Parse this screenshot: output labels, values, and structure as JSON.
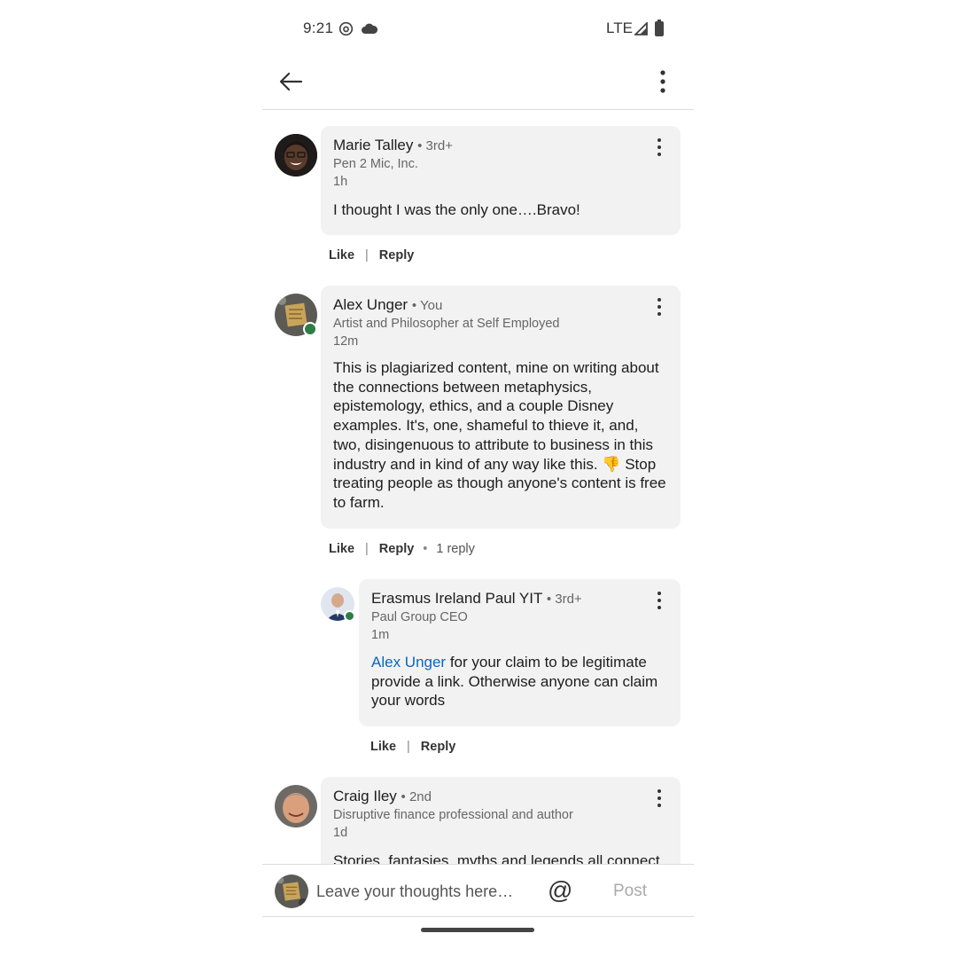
{
  "status_bar": {
    "time": "9:21",
    "network": "LTE"
  },
  "comments": [
    {
      "name": "Marie Talley",
      "degree": "• 3rd+",
      "headline": "Pen 2 Mic, Inc.",
      "time": "1h",
      "text": "I thought I was the only one….Bravo!",
      "like_label": "Like",
      "reply_label": "Reply"
    },
    {
      "name": "Alex Unger",
      "degree": "• You",
      "headline": "Artist and Philosopher at Self Employed",
      "time": "12m",
      "text": "This is plagiarized content, mine on writing about the connections between metaphysics, epistemology, ethics, and a couple Disney examples. It's, one, shameful to thieve it, and, two, disingenuous to attribute to business in this industry and in kind of any way like this. 👎 Stop treating people as though anyone's content is free to farm.",
      "like_label": "Like",
      "reply_label": "Reply",
      "replies_count": "1 reply",
      "replies": [
        {
          "name": "Erasmus Ireland Paul YIT",
          "degree": "• 3rd+",
          "headline": "Paul Group CEO",
          "time": "1m",
          "mention": "Alex Unger",
          "text": " for your claim to be legitimate provide a link. Otherwise anyone can claim your words",
          "like_label": "Like",
          "reply_label": "Reply"
        }
      ]
    },
    {
      "name": "Craig Iley",
      "degree": "• 2nd",
      "headline": "Disruptive finance professional and author",
      "time": "1d",
      "text": "Stories, fantasies, myths and legends all connect"
    }
  ],
  "composer": {
    "placeholder": "Leave your thoughts here…",
    "mention_symbol": "@",
    "post_label": "Post"
  },
  "separators": {
    "pipe": "|",
    "dot": "•"
  }
}
